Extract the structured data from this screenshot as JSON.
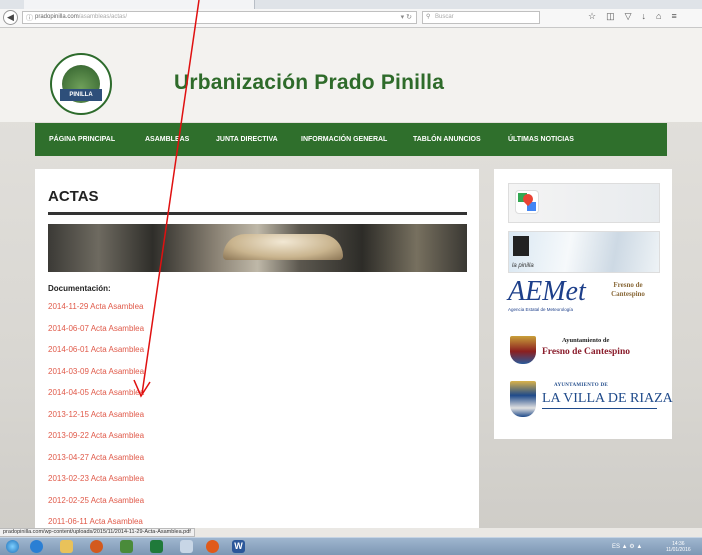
{
  "browser": {
    "url_host": "pradopinilla.com",
    "url_path": "/asambleas/actas/",
    "search_placeholder": "Buscar",
    "toolbar_icons": [
      "star-icon",
      "reader-icon",
      "pocket-icon",
      "download-icon",
      "home-icon",
      "menu-icon"
    ]
  },
  "site": {
    "title": "Urbanización Prado Pinilla",
    "logo_text": "PINILLA",
    "nav": [
      "PÁGINA PRINCIPAL",
      "ASAMBLEAS",
      "JUNTA DIRECTIVA",
      "INFORMACIÓN GENERAL",
      "TABLÓN ANUNCIOS",
      "ÚLTIMAS NOTICIAS"
    ]
  },
  "main": {
    "heading": "ACTAS",
    "doc_label": "Documentación:",
    "documents": [
      "2014-11-29 Acta Asamblea",
      "2014-06-07 Acta Asamblea",
      "2014-06-01 Acta Asamblea",
      "2014-03-09 Acta Asamblea",
      "2014-04-05 Acta Asamblea",
      "2013-12-15 Acta Asamblea",
      "2013-09-22 Acta Asamblea",
      "2013-04-27 Acta Asamblea",
      "2013-02-23 Acta Asamblea",
      "2012-02-25 Acta Asamblea",
      "2011-06-11 Acta Asamblea"
    ]
  },
  "sidebar": {
    "snow_caption": "la pinilla",
    "aemet_logo": "AEMet",
    "aemet_sub": "Agencia Estatal de Meteorología",
    "fresno_small": "Fresno de Cantespino",
    "ayto_fresno_small": "Ayuntamiento de",
    "ayto_fresno_big": "Fresno de Cantespino",
    "riaza_small": "AYUNTAMIENTO DE",
    "riaza_big": "LA VILLA DE RIAZA"
  },
  "status": {
    "link_preview": "pradopinilla.com/wp-content/uploads/2015/11/2014-11-29-Acta-Asamblea.pdf"
  },
  "taskbar": {
    "language": "ES",
    "time": "14:36",
    "date": "11/01/2016"
  },
  "colors": {
    "nav_green": "#2f6f2c",
    "title_green": "#2e6b2a",
    "link_red": "#e05a4a",
    "annotation_red": "#e01010"
  }
}
